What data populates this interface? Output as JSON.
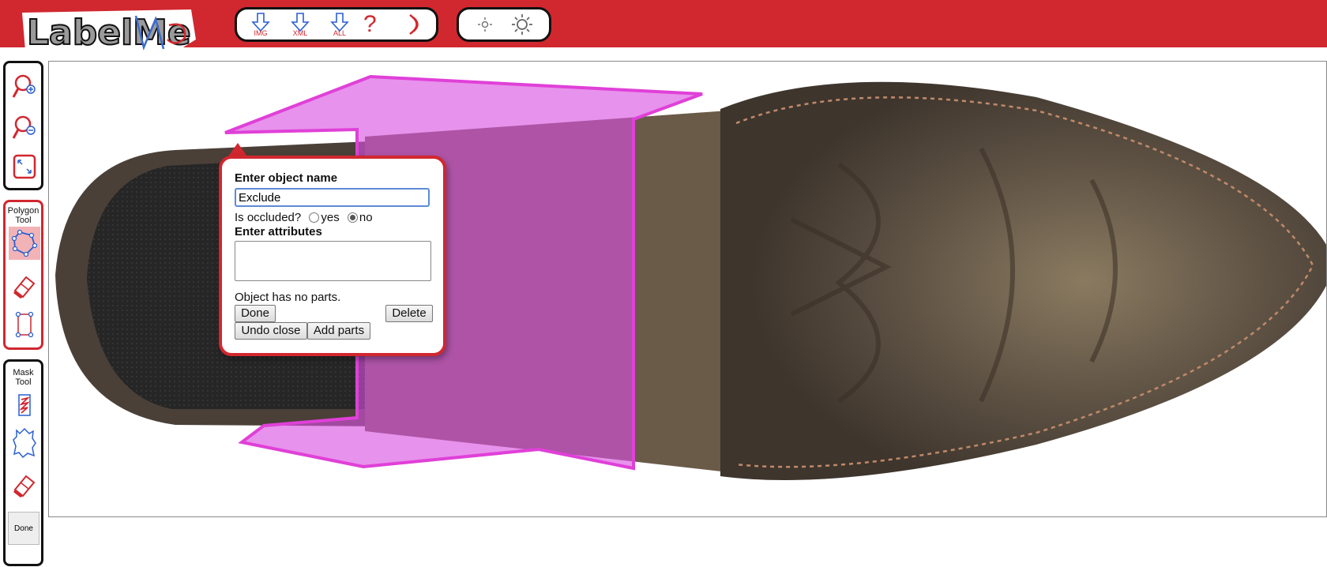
{
  "app": {
    "logo_text": "LabelMe"
  },
  "toolbar": {
    "download_img_label": "IMG",
    "download_xml_label": "XML",
    "download_all_label": "ALL",
    "help_symbol": "?",
    "icons": [
      "download-arrow-icon",
      "help-icon",
      "night-mode-icon",
      "dim-brightness-icon",
      "brightness-icon"
    ]
  },
  "sidebar": {
    "polygon_tool_label": "Polygon Tool",
    "mask_tool_label": "Mask Tool",
    "done_label": "Done"
  },
  "popup": {
    "name_heading": "Enter object name",
    "name_value": "Exclude",
    "occluded_question": "Is occluded?",
    "yes_label": "yes",
    "no_label": "no",
    "occluded_value": "no",
    "attributes_heading": "Enter attributes",
    "attributes_value": "",
    "parts_status": "Object has no parts.",
    "done_button": "Done",
    "delete_button": "Delete",
    "undo_close_button": "Undo close",
    "add_parts_button": "Add parts"
  },
  "colors": {
    "brand_red": "#d1272f",
    "polygon_fill": "#d94fe0",
    "polygon_stroke": "#e040d8",
    "boot_sole": "#4a4038"
  }
}
